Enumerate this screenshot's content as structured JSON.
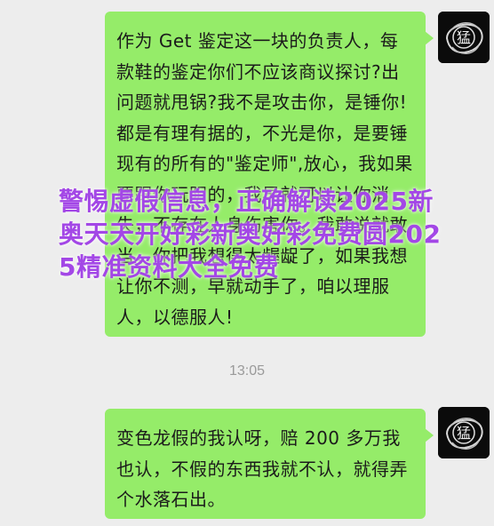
{
  "chat": {
    "messages": [
      {
        "sender": "self",
        "text": "作为 Get 鉴定这一块的负责人，每款鞋的鉴定你们不应该商议探讨?出问题就甩锅?我不是攻击你，是锤你!都是有理有据的，不光是你，是要锤现有的所有的\"鉴定师\",放心，我如果要跟你玩阴的，我早就可以让你消失，不存在人身伤害你。我敢说就敢当，你把我想得太龌龊了，如果我想让你不测，早就动手了，咱以理服人，以德服人!"
      },
      {
        "sender": "self",
        "text": "变色龙假的我认呀，赔 200 多万我也认，不假的东西我就不认，就得弄个水落石出。"
      }
    ],
    "timestamp": "13:05",
    "avatar_char": "猛"
  },
  "overlay": {
    "watermark": "警惕虚假信息，正确解读2025新奥天天开好彩新奥好彩免费圆2025精准资料大全免费"
  },
  "colors": {
    "background": "#ededed",
    "bubble": "#95ec69",
    "watermark": "#a347e6"
  }
}
